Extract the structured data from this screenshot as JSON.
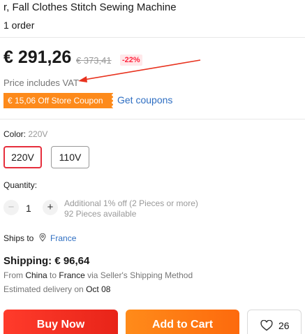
{
  "product": {
    "title": "r, Fall Clothes Stitch Sewing Machine",
    "orders": "1 order"
  },
  "price": {
    "current": "€ 291,26",
    "original": "€ 373,41",
    "discount": "-22%",
    "vat_note": "Price includes VAT"
  },
  "coupon": {
    "badge": "€ 15,06 Off Store Coupon",
    "link": "Get coupons"
  },
  "color": {
    "label": "Color:",
    "selected": "220V",
    "options": [
      "220V",
      "110V"
    ]
  },
  "quantity": {
    "label": "Quantity:",
    "minus": "−",
    "plus": "+",
    "value": "1",
    "offer": "Additional 1% off (2 Pieces or more)",
    "available": "92 Pieces available"
  },
  "shipping": {
    "ships_to_label": "Ships to",
    "country": "France",
    "cost": "Shipping: € 96,64",
    "from_label": "From",
    "from": "China",
    "to_label": "to",
    "to": "France",
    "via": "via Seller's Shipping Method",
    "delivery_label": "Estimated delivery on",
    "delivery_date": "Oct 08"
  },
  "actions": {
    "buy_now": "Buy Now",
    "add_to_cart": "Add to Cart",
    "wishlist_count": "26"
  },
  "colors": {
    "accent_red": "#e62e3c",
    "coupon_orange": "#fd8a1b",
    "link_blue": "#2e6ec2",
    "annotation_arrow": "#e8321e"
  },
  "icons": [
    "location-pin-icon",
    "heart-icon"
  ]
}
